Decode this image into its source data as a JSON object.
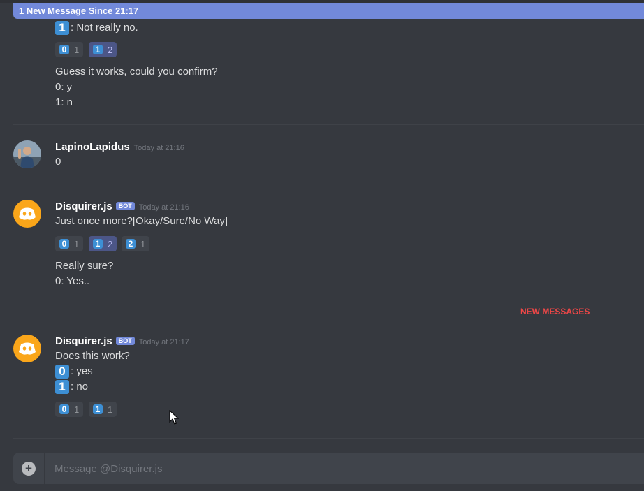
{
  "banner": {
    "text": "1 New Message Since 21:17"
  },
  "msg0": {
    "line1_key": "1",
    "line1_text": ": Not really no.",
    "reactions": [
      {
        "emoji": "0",
        "count": "1",
        "me": false
      },
      {
        "emoji": "1",
        "count": "2",
        "me": true
      }
    ],
    "question": "Guess it works, could you confirm?",
    "opt0": "0: y",
    "opt1": "1: n"
  },
  "msg1": {
    "author": "LapinoLapidus",
    "time": "Today at 21:16",
    "content": "0"
  },
  "msg2": {
    "author": "Disquirer.js",
    "badge": "BOT",
    "time": "Today at 21:16",
    "content": "Just once more?[Okay/Sure/No Way]",
    "reactions": [
      {
        "emoji": "0",
        "count": "1",
        "me": false
      },
      {
        "emoji": "1",
        "count": "2",
        "me": true
      },
      {
        "emoji": "2",
        "count": "1",
        "me": false
      }
    ],
    "question": "Really sure?",
    "opt0": "0: Yes.."
  },
  "new_messages_label": "NEW MESSAGES",
  "msg3": {
    "author": "Disquirer.js",
    "badge": "BOT",
    "time": "Today at 21:17",
    "content": "Does this work?",
    "opt0_key": "0",
    "opt0_text": ": yes",
    "opt1_key": "1",
    "opt1_text": ": no",
    "reactions": [
      {
        "emoji": "0",
        "count": "1",
        "me": false
      },
      {
        "emoji": "1",
        "count": "1",
        "me": false
      }
    ]
  },
  "composer": {
    "placeholder": "Message @Disquirer.js",
    "add_icon": "plus-icon"
  },
  "colors": {
    "blurple": "#7289da",
    "red": "#f04747",
    "bot_avatar": "#faa61a",
    "keycap": "#3d8fd4"
  }
}
